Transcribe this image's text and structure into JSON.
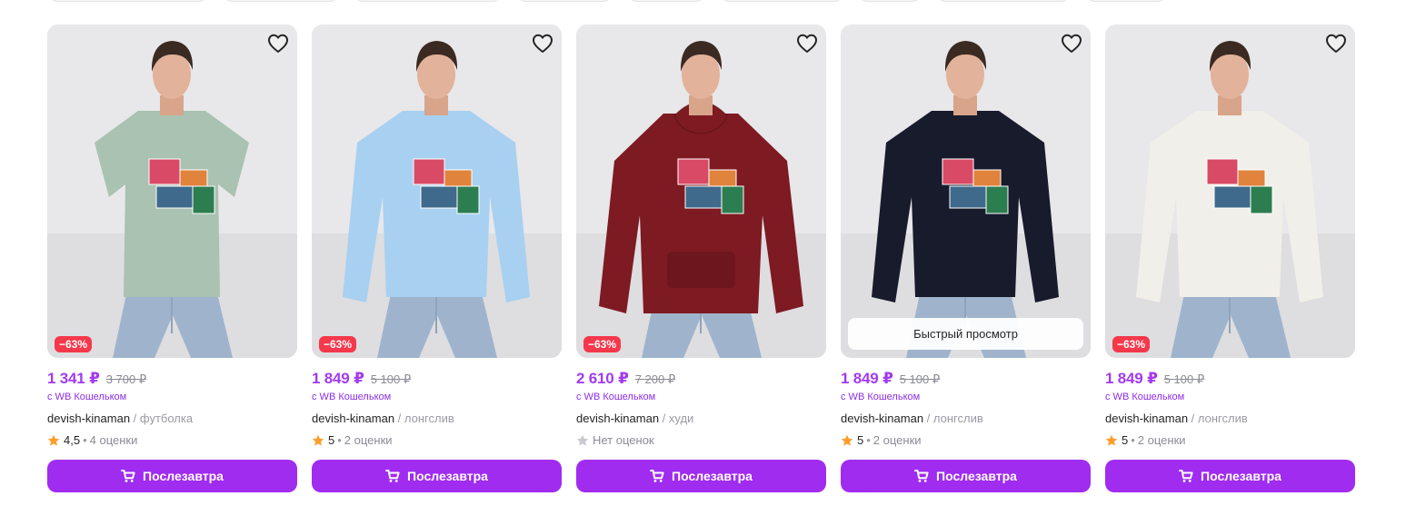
{
  "colors": {
    "accent": "#a02cf0",
    "price": "#a23bf0",
    "discount": "#f5384b",
    "star": "#ff9e2c",
    "star_empty": "#c9c9d0"
  },
  "quick_view_label": "Быстрый просмотр",
  "products": [
    {
      "garment": "tshirt",
      "garment_color": "#a9c2b1",
      "discount": "−63%",
      "price": "1 341 ₽",
      "old_price": "3 700 ₽",
      "wallet": "с WB Кошельком",
      "brand": "devish-kinaman",
      "category": "футболка",
      "rating": "4,5",
      "reviews": "4 оценки",
      "rated": true,
      "button": "Послезавтра",
      "quick_view": false
    },
    {
      "garment": "longsleeve",
      "garment_color": "#a8d0f0",
      "discount": "−63%",
      "price": "1 849 ₽",
      "old_price": "5 100 ₽",
      "wallet": "с WB Кошельком",
      "brand": "devish-kinaman",
      "category": "лонгслив",
      "rating": "5",
      "reviews": "2 оценки",
      "rated": true,
      "button": "Послезавтра",
      "quick_view": false
    },
    {
      "garment": "hoodie",
      "garment_color": "#7e1a22",
      "discount": "−63%",
      "price": "2 610 ₽",
      "old_price": "7 200 ₽",
      "wallet": "с WB Кошельком",
      "brand": "devish-kinaman",
      "category": "худи",
      "rating": "",
      "reviews": "Нет оценок",
      "rated": false,
      "button": "Послезавтра",
      "quick_view": false
    },
    {
      "garment": "longsleeve",
      "garment_color": "#171b2c",
      "discount": "",
      "price": "1 849 ₽",
      "old_price": "5 100 ₽",
      "wallet": "с WB Кошельком",
      "brand": "devish-kinaman",
      "category": "лонгслив",
      "rating": "5",
      "reviews": "2 оценки",
      "rated": true,
      "button": "Послезавтра",
      "quick_view": true
    },
    {
      "garment": "longsleeve",
      "garment_color": "#f1efe9",
      "discount": "−63%",
      "price": "1 849 ₽",
      "old_price": "5 100 ₽",
      "wallet": "с WB Кошельком",
      "brand": "devish-kinaman",
      "category": "лонгслив",
      "rating": "5",
      "reviews": "2 оценки",
      "rated": true,
      "button": "Послезавтра",
      "quick_view": false
    }
  ]
}
